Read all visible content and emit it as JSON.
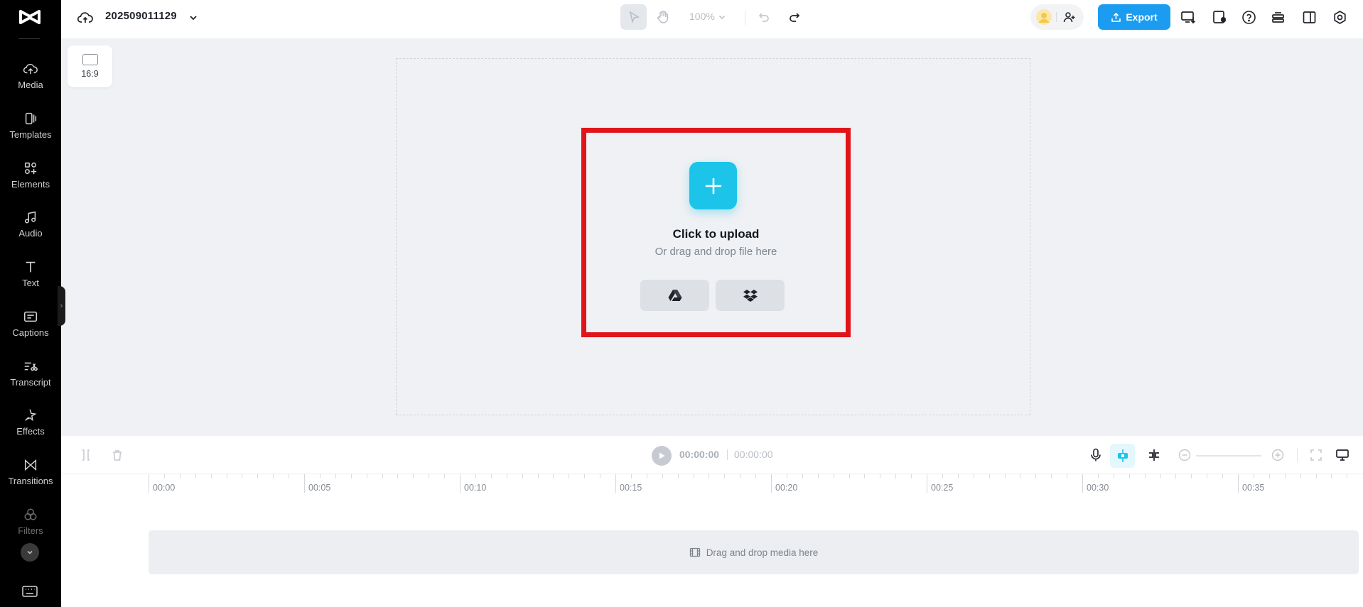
{
  "app": {
    "project_name": "202509011129",
    "zoom_level": "100%",
    "export_label": "Export",
    "accent_color": "#1b9cf0"
  },
  "sidebar": {
    "items": [
      {
        "label": "Media",
        "icon": "cloud-upload-icon"
      },
      {
        "label": "Templates",
        "icon": "templates-icon"
      },
      {
        "label": "Elements",
        "icon": "elements-icon"
      },
      {
        "label": "Audio",
        "icon": "music-note-icon"
      },
      {
        "label": "Text",
        "icon": "text-icon"
      },
      {
        "label": "Captions",
        "icon": "captions-icon"
      },
      {
        "label": "Transcript",
        "icon": "transcript-icon"
      },
      {
        "label": "Effects",
        "icon": "effects-icon"
      },
      {
        "label": "Transitions",
        "icon": "transitions-icon"
      },
      {
        "label": "Filters",
        "icon": "filters-icon"
      }
    ]
  },
  "canvas": {
    "aspect_ratio": "16:9",
    "upload_title": "Click to upload",
    "upload_subtitle": "Or drag and drop file here",
    "upload_accent": "#1cc4ea",
    "highlight_color": "#e0141a"
  },
  "timeline": {
    "current_time": "00:00:00",
    "total_time": "00:00:00",
    "ruler_labels": [
      "00:00",
      "00:05",
      "00:10",
      "00:15",
      "00:20",
      "00:25",
      "00:30",
      "00:35"
    ],
    "drop_hint": "Drag and drop media here"
  }
}
